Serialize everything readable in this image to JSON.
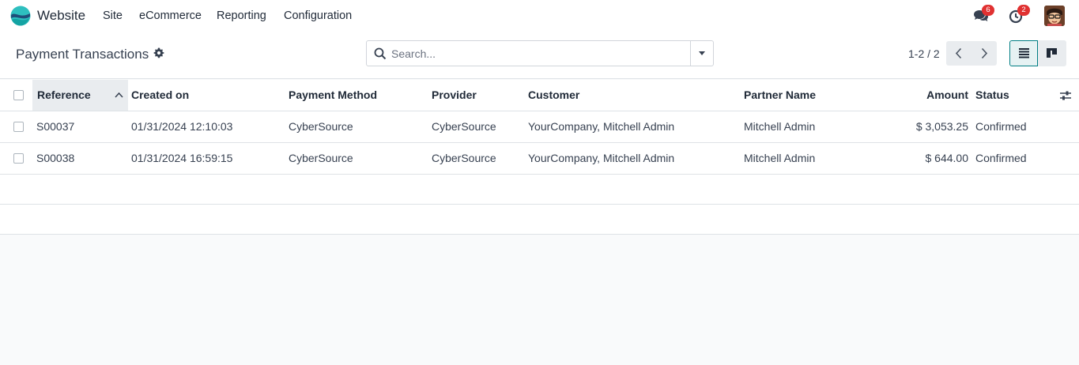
{
  "navbar": {
    "app_name": "Website",
    "menu": [
      "Site",
      "eCommerce",
      "Reporting",
      "Configuration"
    ],
    "messages_count": "6",
    "activities_count": "2",
    "icons": {
      "app": "website-logo-icon",
      "messages": "chat-bubbles-icon",
      "activities": "clock-icon",
      "user": "user-avatar"
    }
  },
  "control_panel": {
    "title": "Payment Transactions",
    "search_placeholder": "Search...",
    "pager": "1-2 / 2"
  },
  "table": {
    "columns": [
      "Reference",
      "Created on",
      "Payment Method",
      "Provider",
      "Customer",
      "Partner Name",
      "Amount",
      "Status"
    ],
    "rows": [
      {
        "reference": "S00037",
        "created_on": "01/31/2024 12:10:03",
        "payment_method": "CyberSource",
        "provider": "CyberSource",
        "customer": "YourCompany, Mitchell Admin",
        "partner_name": "Mitchell Admin",
        "amount": "$ 3,053.25",
        "status": "Confirmed"
      },
      {
        "reference": "S00038",
        "created_on": "01/31/2024 16:59:15",
        "payment_method": "CyberSource",
        "provider": "CyberSource",
        "customer": "YourCompany, Mitchell Admin",
        "partner_name": "Mitchell Admin",
        "amount": "$ 644.00",
        "status": "Confirmed"
      }
    ]
  },
  "colors": {
    "accent": "#017e84",
    "badge": "#e03131",
    "background": "#f9fafb"
  }
}
